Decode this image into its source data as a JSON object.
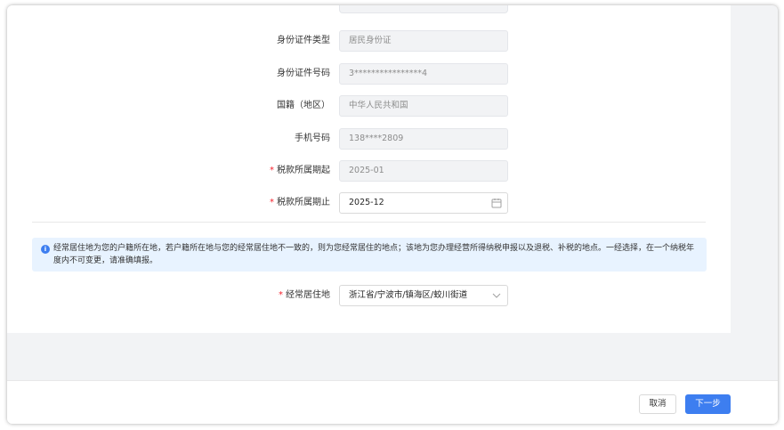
{
  "form": {
    "fields": [
      {
        "label": "身份证件类型",
        "value": "居民身份证",
        "required": false
      },
      {
        "label": "身份证件号码",
        "value": "3****************4",
        "required": false
      },
      {
        "label": "国籍（地区）",
        "value": "中华人民共和国",
        "required": false
      },
      {
        "label": "手机号码",
        "value": "138****2809",
        "required": false
      },
      {
        "label": "税款所属期起",
        "value": "2025-01",
        "required": true
      },
      {
        "label": "税款所属期止",
        "value": "2025-12",
        "required": true
      }
    ],
    "required_mark": "*",
    "notice": "经常居住地为您的户籍所在地，若户籍所在地与您的经常居住地不一致的，则为您经常居住的地点；该地为您办理经营所得纳税申报以及退税、补税的地点。一经选择，在一个纳税年度内不可变更，请准确填报。",
    "residence": {
      "label": "经常居住地",
      "value": "浙江省/宁波市/镇海区/蛟川街道",
      "required": true
    }
  },
  "icons": {
    "info": "info-icon",
    "calendar": "calendar-icon",
    "dropdown": "chevron-down-icon"
  },
  "footer": {
    "cancel_label": "取消",
    "next_label": "下一步"
  },
  "colors": {
    "primary": "#3d7ef0",
    "required": "#f5222d",
    "notice_bg": "#e8f3ff",
    "disabled_bg": "#f2f3f5"
  }
}
